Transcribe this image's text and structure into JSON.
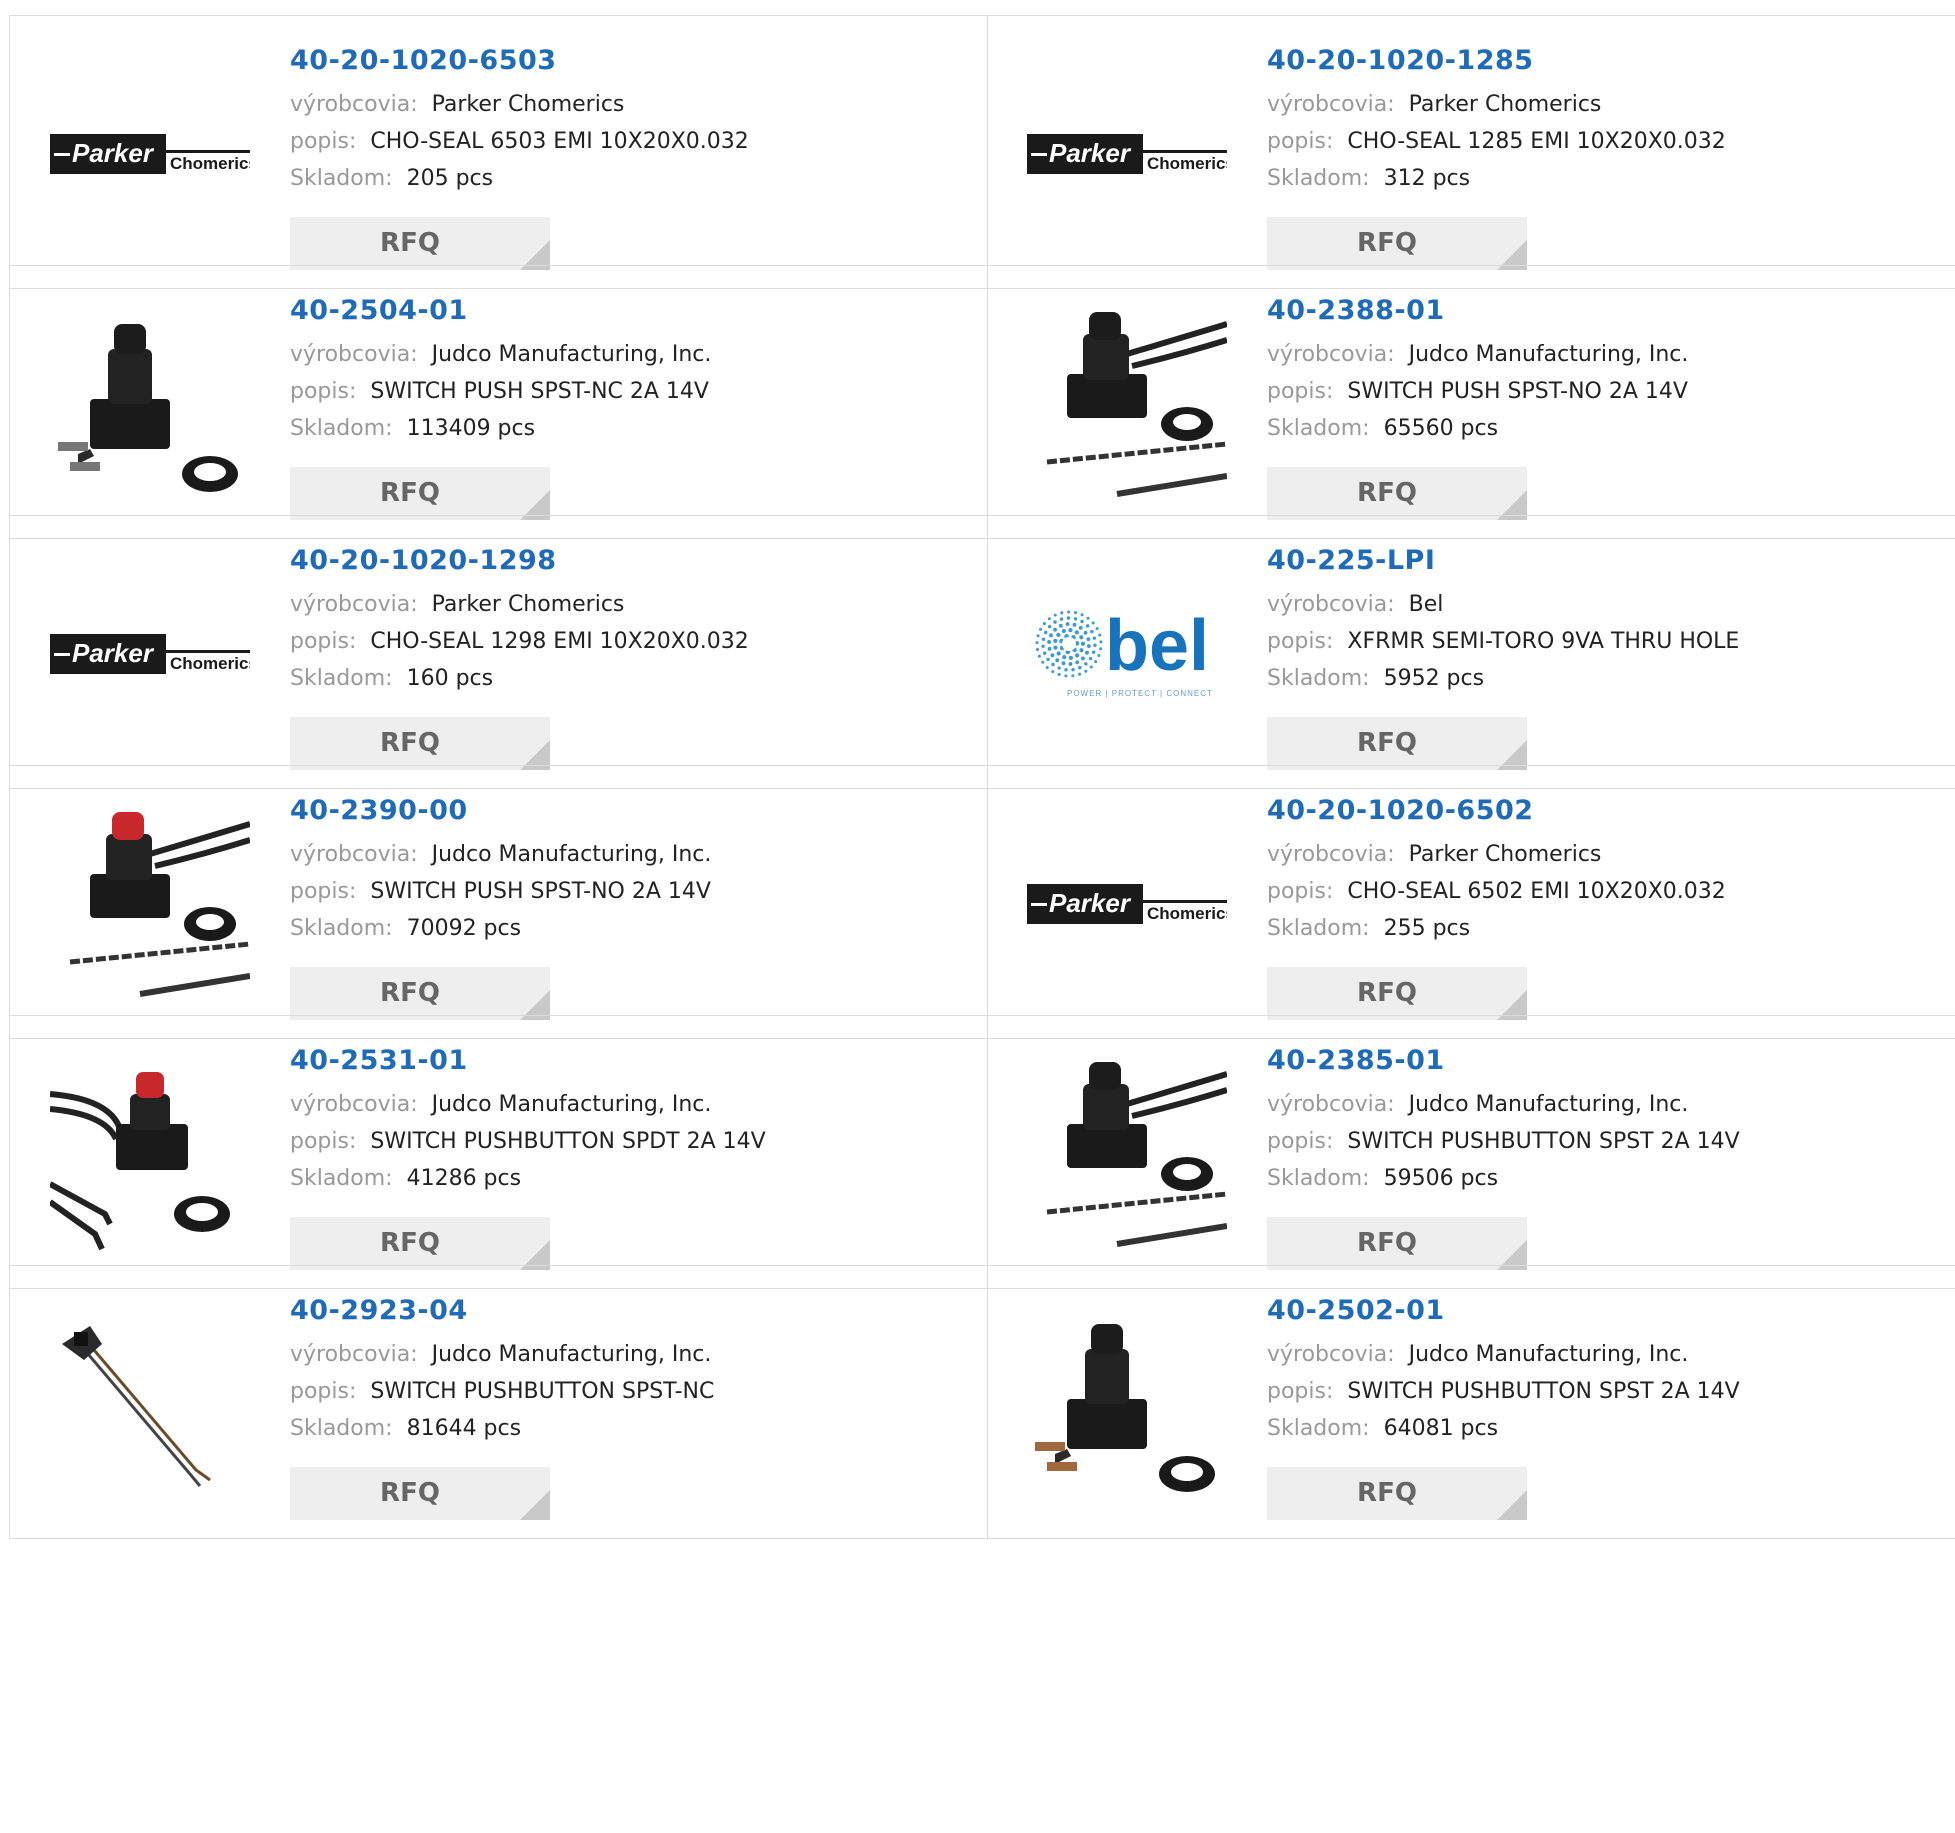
{
  "labels": {
    "manufacturer": "výrobcovia:",
    "description": "popis:",
    "stock": "Skladom:",
    "rfq": "RFQ"
  },
  "products": [
    {
      "part": "40-20-1020-6503",
      "manufacturer": "Parker Chomerics",
      "description": "CHO-SEAL 6503 EMI 10X20X0.032",
      "stock": "205 pcs",
      "image": "parker-logo"
    },
    {
      "part": "40-20-1020-1285",
      "manufacturer": "Parker Chomerics",
      "description": "CHO-SEAL 1285 EMI 10X20X0.032",
      "stock": "312 pcs",
      "image": "parker-logo"
    },
    {
      "part": "40-2504-01",
      "manufacturer": "Judco Manufacturing, Inc.",
      "description": "SWITCH PUSH SPST-NC 2A 14V",
      "stock": "113409 pcs",
      "image": "switch-terminals"
    },
    {
      "part": "40-2388-01",
      "manufacturer": "Judco Manufacturing, Inc.",
      "description": "SWITCH PUSH SPST-NO 2A 14V",
      "stock": "65560 pcs",
      "image": "switch-wires"
    },
    {
      "part": "40-20-1020-1298",
      "manufacturer": "Parker Chomerics",
      "description": "CHO-SEAL 1298 EMI 10X20X0.032",
      "stock": "160 pcs",
      "image": "parker-logo"
    },
    {
      "part": "40-225-LPI",
      "manufacturer": "Bel",
      "description": "XFRMR SEMI-TORO 9VA THRU HOLE",
      "stock": "5952 pcs",
      "image": "bel-logo"
    },
    {
      "part": "40-2390-00",
      "manufacturer": "Judco Manufacturing, Inc.",
      "description": "SWITCH PUSH SPST-NO 2A 14V",
      "stock": "70092 pcs",
      "image": "switch-wires-red"
    },
    {
      "part": "40-20-1020-6502",
      "manufacturer": "Parker Chomerics",
      "description": "CHO-SEAL 6502 EMI 10X20X0.032",
      "stock": "255 pcs",
      "image": "parker-logo"
    },
    {
      "part": "40-2531-01",
      "manufacturer": "Judco Manufacturing, Inc.",
      "description": "SWITCH PUSHBUTTON SPDT 2A 14V",
      "stock": "41286 pcs",
      "image": "switch-wires-left-red"
    },
    {
      "part": "40-2385-01",
      "manufacturer": "Judco Manufacturing, Inc.",
      "description": "SWITCH PUSHBUTTON SPST 2A 14V",
      "stock": "59506 pcs",
      "image": "switch-wires"
    },
    {
      "part": "40-2923-04",
      "manufacturer": "Judco Manufacturing, Inc.",
      "description": "SWITCH PUSHBUTTON SPST-NC",
      "stock": "81644 pcs",
      "image": "mini-switch-wires"
    },
    {
      "part": "40-2502-01",
      "manufacturer": "Judco Manufacturing, Inc.",
      "description": "SWITCH PUSHBUTTON SPST 2A 14V",
      "stock": "64081 pcs",
      "image": "switch-terminals-brass"
    }
  ],
  "logos": {
    "parker": {
      "name": "Parker",
      "sub": "Chomerics"
    },
    "bel": {
      "name": "bel",
      "tagline": "POWER | PROTECT | CONNECT"
    }
  }
}
